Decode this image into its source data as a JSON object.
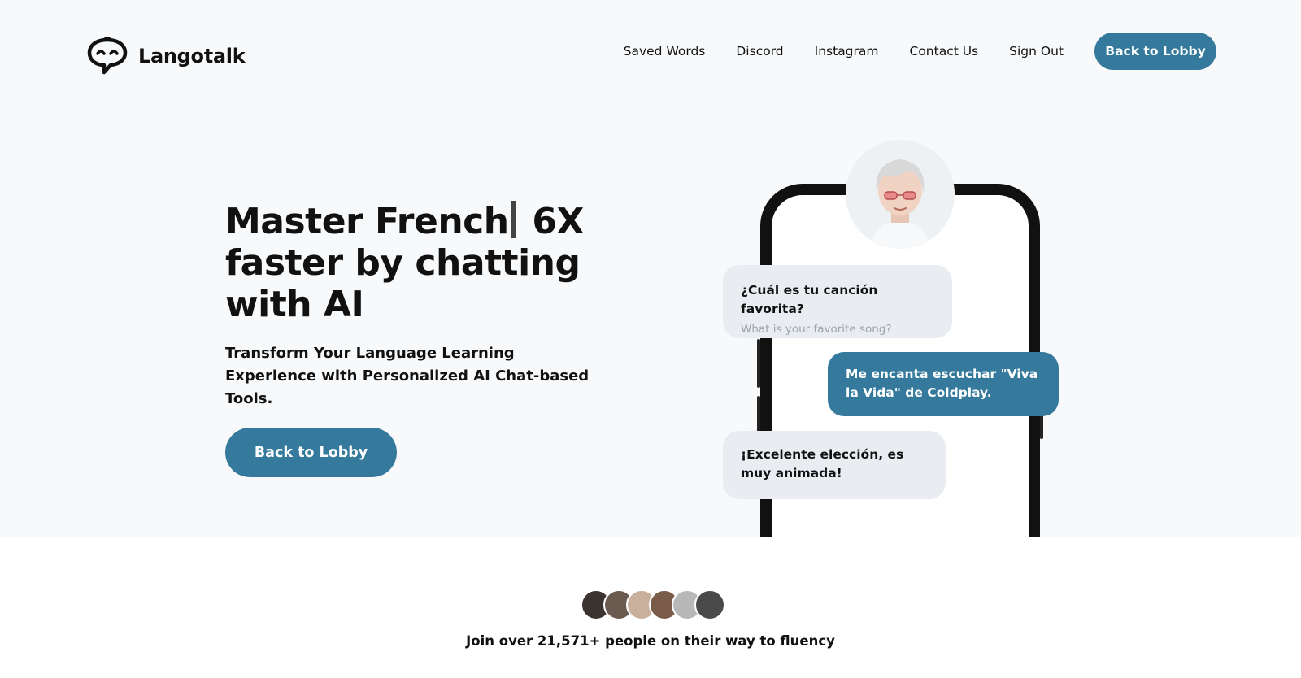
{
  "brand": {
    "name": "Langotalk"
  },
  "nav": {
    "links": [
      "Saved Words",
      "Discord",
      "Instagram",
      "Contact Us",
      "Sign Out"
    ],
    "cta_label": "Back to Lobby"
  },
  "hero": {
    "title_part1": "Master French",
    "title_part2": " 6X faster by chatting with AI",
    "subtitle": "Transform Your Language Learning Experience with Personalized AI Chat-based Tools.",
    "cta_label": "Back to Lobby"
  },
  "chat": {
    "messages": [
      {
        "role": "ai",
        "text": "¿Cuál es tu canción favorita?",
        "translation": "What is your favorite song?"
      },
      {
        "role": "user",
        "text": "Me encanta escuchar \"Viva la Vida\" de Coldplay."
      },
      {
        "role": "ai",
        "text": "¡Excelente elección, es muy animada!"
      }
    ]
  },
  "social_proof": {
    "text": "Join over 21,571+ people on their way to fluency",
    "avatar_count": 6
  },
  "colors": {
    "accent": "#357a9c",
    "hero_bg": "#f7f9fb",
    "ai_bubble": "#e9edf2"
  }
}
